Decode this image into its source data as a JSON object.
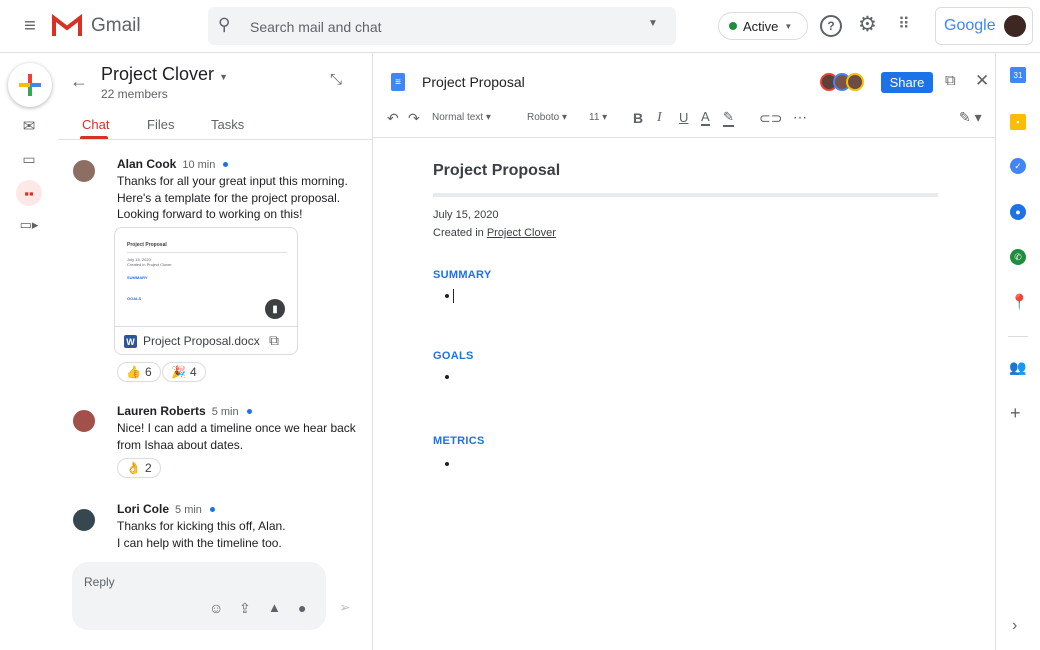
{
  "app": {
    "name": "Gmail",
    "search_placeholder": "Search mail and chat",
    "status": "Active",
    "brand": "Google"
  },
  "nav": {
    "icons": [
      "mail-icon",
      "chat-icon",
      "rooms-icon",
      "meet-icon"
    ]
  },
  "room": {
    "title": "Project Clover",
    "members": "22 members",
    "tabs": [
      "Chat",
      "Files",
      "Tasks"
    ],
    "active_tab": "Chat"
  },
  "messages": [
    {
      "name": "Alan Cook",
      "time": "10 min",
      "lines": [
        "Thanks for all your great input this morning.",
        "Here's a template for the project proposal.",
        "Looking forward to working on this!"
      ],
      "attachment": {
        "filename": "Project Proposal.docx",
        "thumb": {
          "title": "Project Proposal",
          "date": "July 15, 2020",
          "created": "Created in Project Clover",
          "s1": "SUMMARY",
          "s2": "GOALS"
        }
      },
      "reactions": [
        {
          "emoji": "👍",
          "count": "6"
        },
        {
          "emoji": "🎉",
          "count": "4"
        }
      ]
    },
    {
      "name": "Lauren Roberts",
      "time": "5 min",
      "lines": [
        "Nice! I can add a timeline once we hear back",
        "from Ishaa about dates."
      ],
      "reactions": [
        {
          "emoji": "👌",
          "count": "2"
        }
      ]
    },
    {
      "name": "Lori Cole",
      "time": "5 min",
      "lines": [
        "Thanks for kicking this off, Alan.",
        "I can help with the timeline too."
      ]
    }
  ],
  "reply": {
    "placeholder": "Reply"
  },
  "doc": {
    "title": "Project Proposal",
    "share": "Share",
    "toolbar": {
      "style": "Normal text",
      "font": "Roboto",
      "size": "11"
    },
    "heading": "Project Proposal",
    "date": "July 15, 2020",
    "created_prefix": "Created in ",
    "created_link": "Project Clover",
    "sections": [
      "SUMMARY",
      "GOALS",
      "METRICS"
    ]
  },
  "colors": {
    "accent": "#1a73e8",
    "gmail_red": "#d93025",
    "active": "#1e8e3e"
  }
}
